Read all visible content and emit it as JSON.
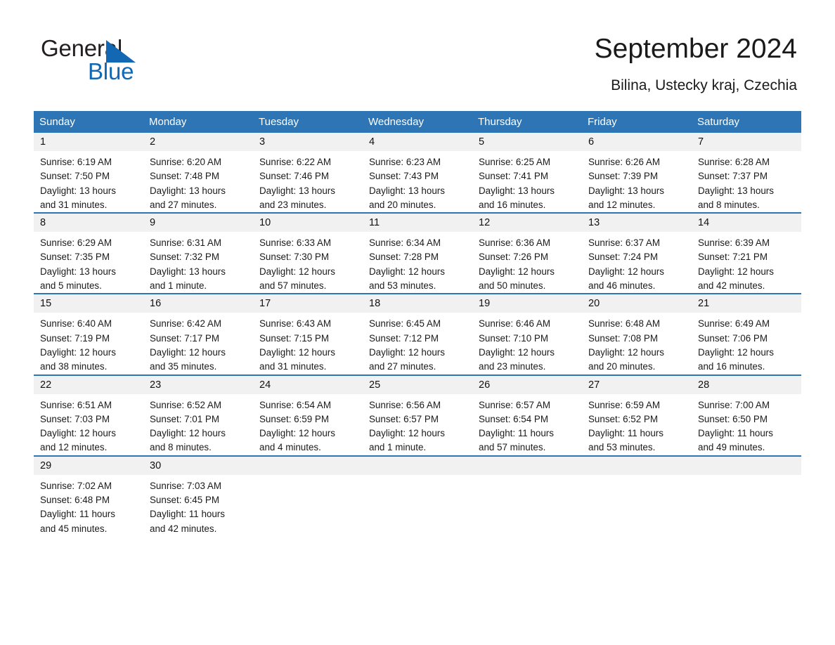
{
  "brand": {
    "name_part1": "General",
    "name_part2": "Blue",
    "accent_color": "#1268b3"
  },
  "header": {
    "title": "September 2024",
    "subtitle": "Bilina, Ustecky kraj, Czechia"
  },
  "calendar": {
    "header_bg": "#2e75b6",
    "day_band_bg": "#f1f1f1",
    "weekday_headers": [
      "Sunday",
      "Monday",
      "Tuesday",
      "Wednesday",
      "Thursday",
      "Friday",
      "Saturday"
    ],
    "weeks": [
      [
        {
          "day": "1",
          "sunrise": "Sunrise: 6:19 AM",
          "sunset": "Sunset: 7:50 PM",
          "daylight_line1": "Daylight: 13 hours",
          "daylight_line2": "and 31 minutes."
        },
        {
          "day": "2",
          "sunrise": "Sunrise: 6:20 AM",
          "sunset": "Sunset: 7:48 PM",
          "daylight_line1": "Daylight: 13 hours",
          "daylight_line2": "and 27 minutes."
        },
        {
          "day": "3",
          "sunrise": "Sunrise: 6:22 AM",
          "sunset": "Sunset: 7:46 PM",
          "daylight_line1": "Daylight: 13 hours",
          "daylight_line2": "and 23 minutes."
        },
        {
          "day": "4",
          "sunrise": "Sunrise: 6:23 AM",
          "sunset": "Sunset: 7:43 PM",
          "daylight_line1": "Daylight: 13 hours",
          "daylight_line2": "and 20 minutes."
        },
        {
          "day": "5",
          "sunrise": "Sunrise: 6:25 AM",
          "sunset": "Sunset: 7:41 PM",
          "daylight_line1": "Daylight: 13 hours",
          "daylight_line2": "and 16 minutes."
        },
        {
          "day": "6",
          "sunrise": "Sunrise: 6:26 AM",
          "sunset": "Sunset: 7:39 PM",
          "daylight_line1": "Daylight: 13 hours",
          "daylight_line2": "and 12 minutes."
        },
        {
          "day": "7",
          "sunrise": "Sunrise: 6:28 AM",
          "sunset": "Sunset: 7:37 PM",
          "daylight_line1": "Daylight: 13 hours",
          "daylight_line2": "and 8 minutes."
        }
      ],
      [
        {
          "day": "8",
          "sunrise": "Sunrise: 6:29 AM",
          "sunset": "Sunset: 7:35 PM",
          "daylight_line1": "Daylight: 13 hours",
          "daylight_line2": "and 5 minutes."
        },
        {
          "day": "9",
          "sunrise": "Sunrise: 6:31 AM",
          "sunset": "Sunset: 7:32 PM",
          "daylight_line1": "Daylight: 13 hours",
          "daylight_line2": "and 1 minute."
        },
        {
          "day": "10",
          "sunrise": "Sunrise: 6:33 AM",
          "sunset": "Sunset: 7:30 PM",
          "daylight_line1": "Daylight: 12 hours",
          "daylight_line2": "and 57 minutes."
        },
        {
          "day": "11",
          "sunrise": "Sunrise: 6:34 AM",
          "sunset": "Sunset: 7:28 PM",
          "daylight_line1": "Daylight: 12 hours",
          "daylight_line2": "and 53 minutes."
        },
        {
          "day": "12",
          "sunrise": "Sunrise: 6:36 AM",
          "sunset": "Sunset: 7:26 PM",
          "daylight_line1": "Daylight: 12 hours",
          "daylight_line2": "and 50 minutes."
        },
        {
          "day": "13",
          "sunrise": "Sunrise: 6:37 AM",
          "sunset": "Sunset: 7:24 PM",
          "daylight_line1": "Daylight: 12 hours",
          "daylight_line2": "and 46 minutes."
        },
        {
          "day": "14",
          "sunrise": "Sunrise: 6:39 AM",
          "sunset": "Sunset: 7:21 PM",
          "daylight_line1": "Daylight: 12 hours",
          "daylight_line2": "and 42 minutes."
        }
      ],
      [
        {
          "day": "15",
          "sunrise": "Sunrise: 6:40 AM",
          "sunset": "Sunset: 7:19 PM",
          "daylight_line1": "Daylight: 12 hours",
          "daylight_line2": "and 38 minutes."
        },
        {
          "day": "16",
          "sunrise": "Sunrise: 6:42 AM",
          "sunset": "Sunset: 7:17 PM",
          "daylight_line1": "Daylight: 12 hours",
          "daylight_line2": "and 35 minutes."
        },
        {
          "day": "17",
          "sunrise": "Sunrise: 6:43 AM",
          "sunset": "Sunset: 7:15 PM",
          "daylight_line1": "Daylight: 12 hours",
          "daylight_line2": "and 31 minutes."
        },
        {
          "day": "18",
          "sunrise": "Sunrise: 6:45 AM",
          "sunset": "Sunset: 7:12 PM",
          "daylight_line1": "Daylight: 12 hours",
          "daylight_line2": "and 27 minutes."
        },
        {
          "day": "19",
          "sunrise": "Sunrise: 6:46 AM",
          "sunset": "Sunset: 7:10 PM",
          "daylight_line1": "Daylight: 12 hours",
          "daylight_line2": "and 23 minutes."
        },
        {
          "day": "20",
          "sunrise": "Sunrise: 6:48 AM",
          "sunset": "Sunset: 7:08 PM",
          "daylight_line1": "Daylight: 12 hours",
          "daylight_line2": "and 20 minutes."
        },
        {
          "day": "21",
          "sunrise": "Sunrise: 6:49 AM",
          "sunset": "Sunset: 7:06 PM",
          "daylight_line1": "Daylight: 12 hours",
          "daylight_line2": "and 16 minutes."
        }
      ],
      [
        {
          "day": "22",
          "sunrise": "Sunrise: 6:51 AM",
          "sunset": "Sunset: 7:03 PM",
          "daylight_line1": "Daylight: 12 hours",
          "daylight_line2": "and 12 minutes."
        },
        {
          "day": "23",
          "sunrise": "Sunrise: 6:52 AM",
          "sunset": "Sunset: 7:01 PM",
          "daylight_line1": "Daylight: 12 hours",
          "daylight_line2": "and 8 minutes."
        },
        {
          "day": "24",
          "sunrise": "Sunrise: 6:54 AM",
          "sunset": "Sunset: 6:59 PM",
          "daylight_line1": "Daylight: 12 hours",
          "daylight_line2": "and 4 minutes."
        },
        {
          "day": "25",
          "sunrise": "Sunrise: 6:56 AM",
          "sunset": "Sunset: 6:57 PM",
          "daylight_line1": "Daylight: 12 hours",
          "daylight_line2": "and 1 minute."
        },
        {
          "day": "26",
          "sunrise": "Sunrise: 6:57 AM",
          "sunset": "Sunset: 6:54 PM",
          "daylight_line1": "Daylight: 11 hours",
          "daylight_line2": "and 57 minutes."
        },
        {
          "day": "27",
          "sunrise": "Sunrise: 6:59 AM",
          "sunset": "Sunset: 6:52 PM",
          "daylight_line1": "Daylight: 11 hours",
          "daylight_line2": "and 53 minutes."
        },
        {
          "day": "28",
          "sunrise": "Sunrise: 7:00 AM",
          "sunset": "Sunset: 6:50 PM",
          "daylight_line1": "Daylight: 11 hours",
          "daylight_line2": "and 49 minutes."
        }
      ],
      [
        {
          "day": "29",
          "sunrise": "Sunrise: 7:02 AM",
          "sunset": "Sunset: 6:48 PM",
          "daylight_line1": "Daylight: 11 hours",
          "daylight_line2": "and 45 minutes."
        },
        {
          "day": "30",
          "sunrise": "Sunrise: 7:03 AM",
          "sunset": "Sunset: 6:45 PM",
          "daylight_line1": "Daylight: 11 hours",
          "daylight_line2": "and 42 minutes."
        },
        {
          "day": "",
          "sunrise": "",
          "sunset": "",
          "daylight_line1": "",
          "daylight_line2": ""
        },
        {
          "day": "",
          "sunrise": "",
          "sunset": "",
          "daylight_line1": "",
          "daylight_line2": ""
        },
        {
          "day": "",
          "sunrise": "",
          "sunset": "",
          "daylight_line1": "",
          "daylight_line2": ""
        },
        {
          "day": "",
          "sunrise": "",
          "sunset": "",
          "daylight_line1": "",
          "daylight_line2": ""
        },
        {
          "day": "",
          "sunrise": "",
          "sunset": "",
          "daylight_line1": "",
          "daylight_line2": ""
        }
      ]
    ]
  }
}
